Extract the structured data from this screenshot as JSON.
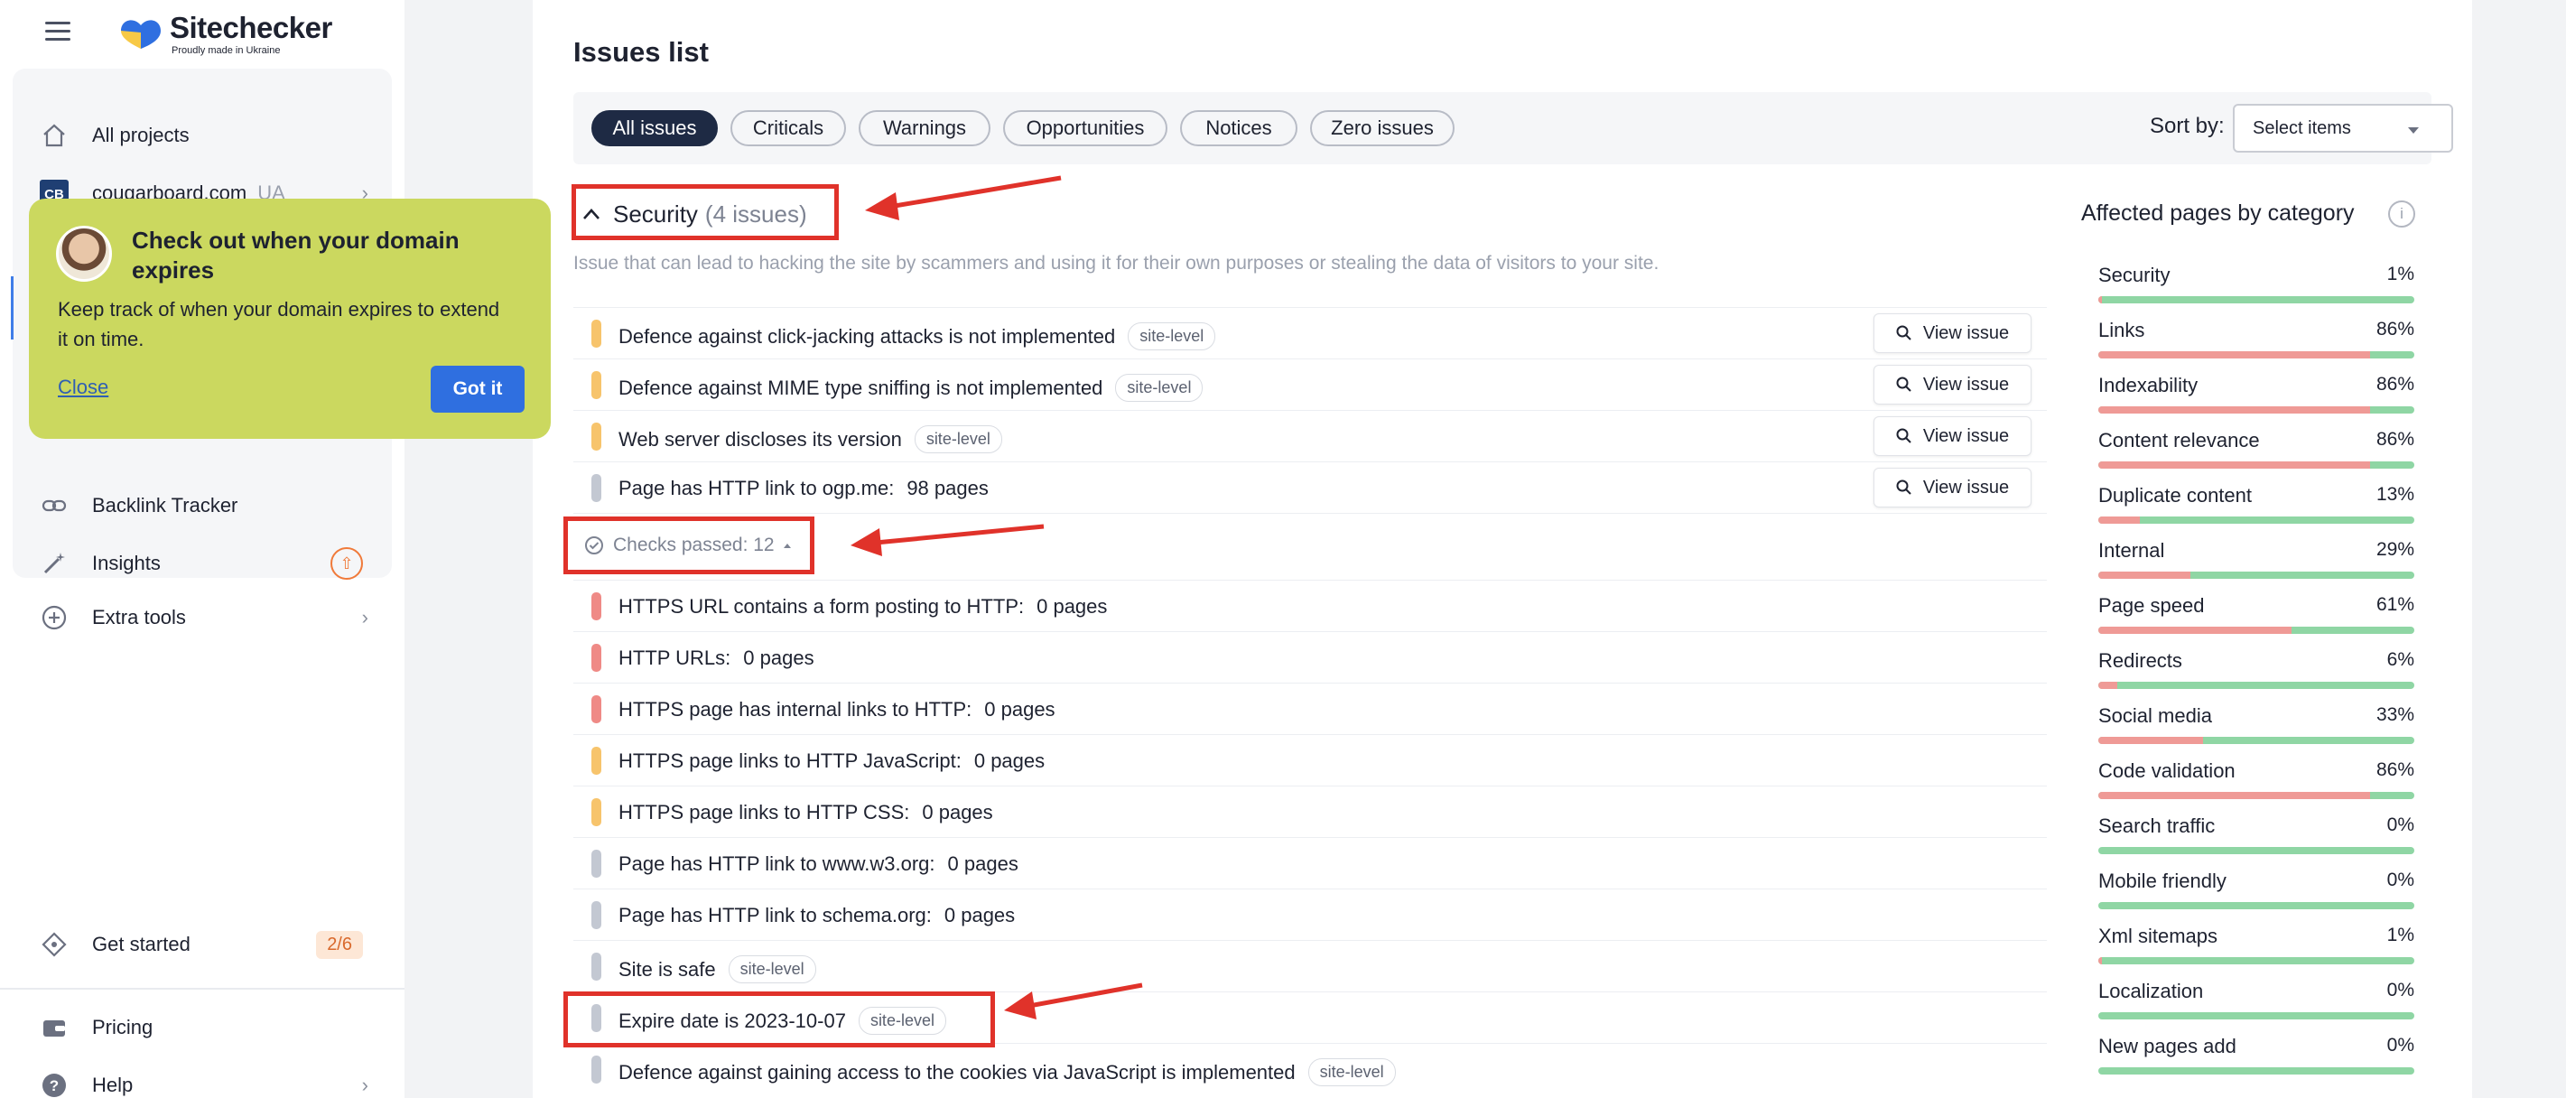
{
  "brand": {
    "name": "Sitechecker",
    "tagline": "Proudly made in Ukraine"
  },
  "sidebar": {
    "items": [
      {
        "label": "All projects"
      },
      {
        "label": "cougarboard.com",
        "sub": "UA"
      },
      {
        "label": "Backlink Tracker"
      },
      {
        "label": "Insights"
      },
      {
        "label": "Extra tools"
      },
      {
        "label": "Get started",
        "badge": "2/6"
      },
      {
        "label": "Pricing"
      },
      {
        "label": "Help"
      }
    ]
  },
  "popup": {
    "title": "Check out when your domain expires",
    "text": "Keep track of when your domain expires to extend it on time.",
    "close": "Close",
    "button": "Got it"
  },
  "main": {
    "title": "Issues list",
    "filters": [
      "All issues",
      "Criticals",
      "Warnings",
      "Opportunities",
      "Notices",
      "Zero issues"
    ],
    "sort_label": "Sort by:",
    "sort_placeholder": "Select items",
    "section": {
      "title": "Security",
      "count": "(4 issues)",
      "description": "Issue that can lead to hacking the site by scammers and using it for their own purposes or stealing the data of visitors to your site."
    },
    "view_label": "View issue",
    "issues": [
      {
        "text": "Defence against click-jacking attacks is not implemented",
        "tag": "site-level",
        "severity": "warning"
      },
      {
        "text": "Defence against MIME type sniffing is not implemented",
        "tag": "site-level",
        "severity": "warning"
      },
      {
        "text": "Web server discloses its version",
        "tag": "site-level",
        "severity": "warning"
      },
      {
        "text": "Page has HTTP link to ogp.me:",
        "pages": "98 pages",
        "severity": "notice"
      }
    ],
    "checks_passed": "Checks passed: 12",
    "passed": [
      {
        "text": "HTTPS URL contains a form posting to HTTP:",
        "pages": "0 pages",
        "severity": "critical"
      },
      {
        "text": "HTTP URLs:",
        "pages": "0 pages",
        "severity": "critical"
      },
      {
        "text": "HTTPS page has internal links to HTTP:",
        "pages": "0 pages",
        "severity": "critical"
      },
      {
        "text": "HTTPS page links to HTTP JavaScript:",
        "pages": "0 pages",
        "severity": "warning"
      },
      {
        "text": "HTTPS page links to HTTP CSS:",
        "pages": "0 pages",
        "severity": "warning"
      },
      {
        "text": "Page has HTTP link to www.w3.org:",
        "pages": "0 pages",
        "severity": "notice"
      },
      {
        "text": "Page has HTTP link to schema.org:",
        "pages": "0 pages",
        "severity": "notice"
      },
      {
        "text": "Site is safe",
        "tag": "site-level",
        "severity": "notice"
      },
      {
        "text": "Expire date is 2023-10-07",
        "tag": "site-level",
        "severity": "notice"
      },
      {
        "text": "Defence against gaining access to the cookies via JavaScript is implemented",
        "tag": "site-level",
        "severity": "notice"
      }
    ]
  },
  "affected": {
    "title": "Affected pages by category",
    "categories": [
      {
        "name": "Security",
        "pct": "1%",
        "value": 1
      },
      {
        "name": "Links",
        "pct": "86%",
        "value": 86
      },
      {
        "name": "Indexability",
        "pct": "86%",
        "value": 86
      },
      {
        "name": "Content relevance",
        "pct": "86%",
        "value": 86
      },
      {
        "name": "Duplicate content",
        "pct": "13%",
        "value": 13
      },
      {
        "name": "Internal",
        "pct": "29%",
        "value": 29
      },
      {
        "name": "Page speed",
        "pct": "61%",
        "value": 61
      },
      {
        "name": "Redirects",
        "pct": "6%",
        "value": 6
      },
      {
        "name": "Social media",
        "pct": "33%",
        "value": 33
      },
      {
        "name": "Code validation",
        "pct": "86%",
        "value": 86
      },
      {
        "name": "Search traffic",
        "pct": "0%",
        "value": 0
      },
      {
        "name": "Mobile friendly",
        "pct": "0%",
        "value": 0
      },
      {
        "name": "Xml sitemaps",
        "pct": "1%",
        "value": 1
      },
      {
        "name": "Localization",
        "pct": "0%",
        "value": 0
      },
      {
        "name": "New pages add",
        "pct": "0%",
        "value": 0
      }
    ]
  },
  "colors": {
    "critical": "#ef8a86",
    "warning": "#f7c46c",
    "notice": "#c3c8d2",
    "annotation": "#e0322a",
    "accent": "#2f6fe0"
  }
}
